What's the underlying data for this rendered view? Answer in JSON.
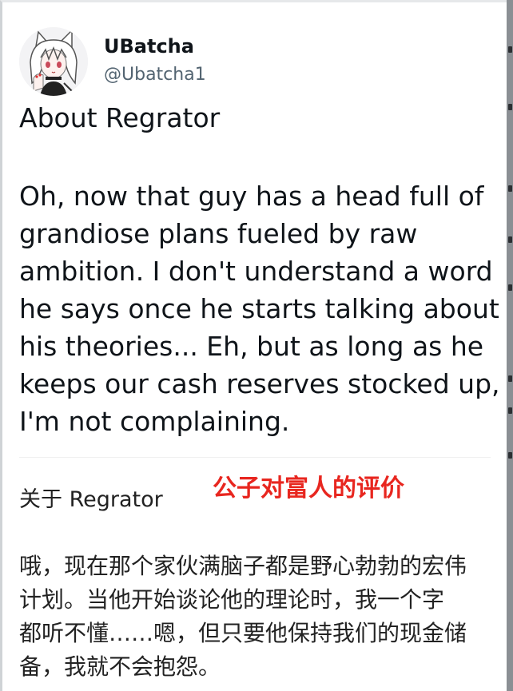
{
  "user": {
    "display_name": "UBatcha",
    "handle": "@Ubatcha1"
  },
  "tweet": {
    "title": "About Regrator",
    "body_lines": [
      "Oh, now that guy has a head full of",
      "grandiose plans fueled by raw",
      "ambition. I don't understand a word",
      "he says once he starts talking about",
      "his theories... Eh, but as long as he",
      "keeps our cash reserves stocked up,",
      "I'm not complaining."
    ]
  },
  "translation": {
    "title": "关于 Regrator",
    "annotation": "公子对富人的评价",
    "annotation_color": "#e8261f",
    "body_lines": [
      "哦，现在那个家伙满脑子都是野心勃勃的宏伟",
      "计划。当他开始谈论他的理论时，我一个字",
      "都听不懂……嗯，但只要他保持我们的现金储",
      "备，我就不会抱怨。"
    ]
  },
  "icons": {
    "avatar": "anime-avatar-icon"
  }
}
